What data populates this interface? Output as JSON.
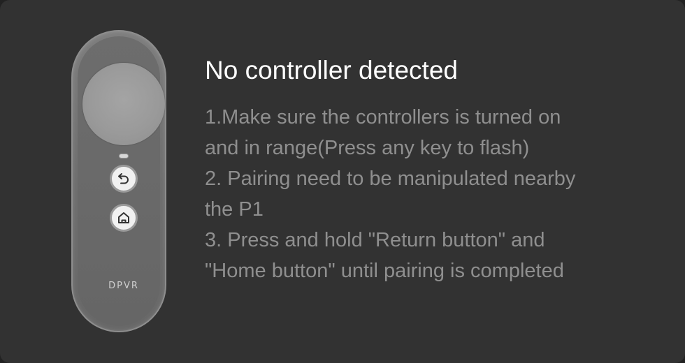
{
  "dialog": {
    "title": "No controller detected",
    "instruction_lines": [
      "1.Make sure the controllers is turned on",
      "and in range(Press any key to flash)",
      "2. Pairing need to be manipulated nearby",
      "the P1",
      "3. Press and hold \"Return button\" and",
      "\"Home button\" until pairing is completed"
    ]
  },
  "controller": {
    "brand": "DPVR",
    "icons": {
      "back": "return-arrow-icon",
      "home": "home-icon"
    }
  },
  "colors": {
    "background": "#323232",
    "title": "#ffffff",
    "body_text": "#8f8f8f"
  }
}
